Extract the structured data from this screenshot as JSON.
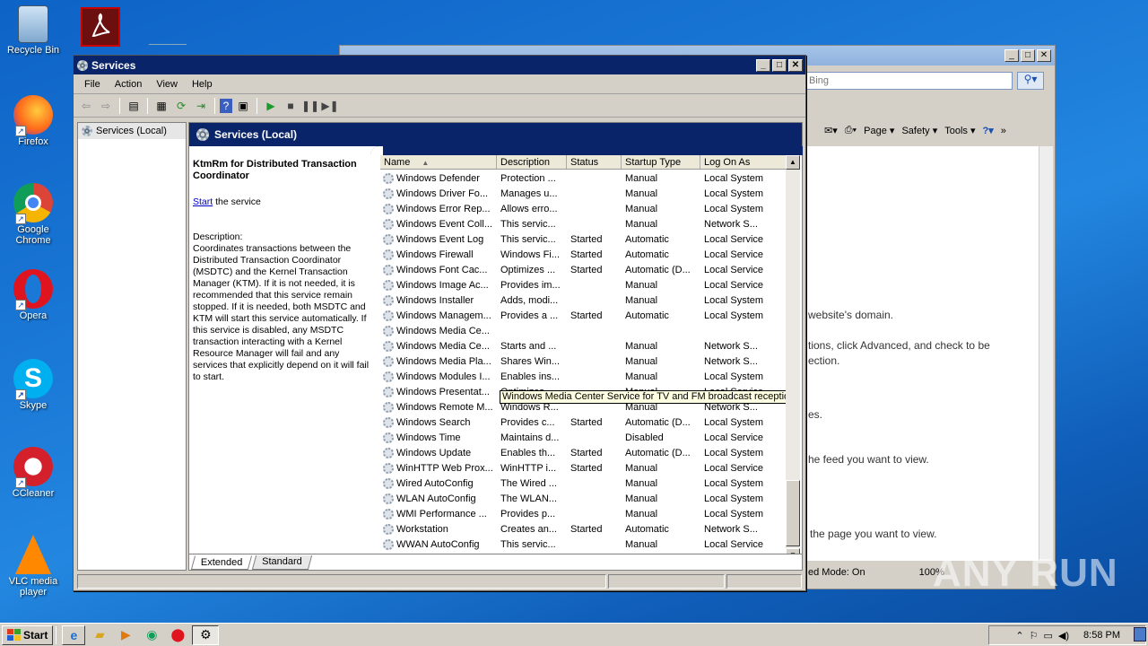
{
  "desktop": {
    "icons": [
      {
        "label": "Recycle Bin",
        "icon": "recycle-bin-icon"
      },
      {
        "label": "Firefox",
        "icon": "firefox-icon"
      },
      {
        "label": "Google Chrome",
        "icon": "chrome-icon"
      },
      {
        "label": "Opera",
        "icon": "opera-icon"
      },
      {
        "label": "Skype",
        "icon": "skype-icon"
      },
      {
        "label": "CCleaner",
        "icon": "ccleaner-icon"
      },
      {
        "label": "VLC media player",
        "icon": "vlc-icon"
      }
    ]
  },
  "ie": {
    "search_placeholder": "Bing",
    "menu": {
      "page": "Page",
      "safety": "Safety",
      "tools": "Tools"
    },
    "body_lines": [
      "website's domain.",
      "tions, click Advanced, and check to be",
      "ection.",
      "es.",
      "he feed you want to view.",
      "the page you want to view."
    ],
    "status_mode": "ed Mode: On",
    "zoom": "100%"
  },
  "services": {
    "title": "Services",
    "menu": [
      "File",
      "Action",
      "View",
      "Help"
    ],
    "tree_item": "Services (Local)",
    "header": "Services (Local)",
    "selected_service": "KtmRm for Distributed Transaction Coordinator",
    "start_link": "Start",
    "start_suffix": " the service",
    "description_label": "Description:",
    "description": "Coordinates transactions between the Distributed Transaction Coordinator (MSDTC) and the Kernel Transaction Manager (KTM). If it is not needed, it is recommended that this service remain stopped. If it is needed, both MSDTC and KTM will start this service automatically. If this service is disabled, any MSDTC transaction interacting with a Kernel Resource Manager will fail and any services that explicitly depend on it will fail to start.",
    "columns": [
      "Name",
      "Description",
      "Status",
      "Startup Type",
      "Log On As"
    ],
    "rows": [
      [
        "Windows Defender",
        "Protection ...",
        "",
        "Manual",
        "Local System"
      ],
      [
        "Windows Driver Fo...",
        "Manages u...",
        "",
        "Manual",
        "Local System"
      ],
      [
        "Windows Error Rep...",
        "Allows erro...",
        "",
        "Manual",
        "Local System"
      ],
      [
        "Windows Event Coll...",
        "This servic...",
        "",
        "Manual",
        "Network S..."
      ],
      [
        "Windows Event Log",
        "This servic...",
        "Started",
        "Automatic",
        "Local Service"
      ],
      [
        "Windows Firewall",
        "Windows Fi...",
        "Started",
        "Automatic",
        "Local Service"
      ],
      [
        "Windows Font Cac...",
        "Optimizes ...",
        "Started",
        "Automatic (D...",
        "Local Service"
      ],
      [
        "Windows Image Ac...",
        "Provides im...",
        "",
        "Manual",
        "Local Service"
      ],
      [
        "Windows Installer",
        "Adds, modi...",
        "",
        "Manual",
        "Local System"
      ],
      [
        "Windows Managem...",
        "Provides a ...",
        "Started",
        "Automatic",
        "Local System"
      ],
      [
        "Windows Media Ce...",
        "",
        "",
        "",
        ""
      ],
      [
        "Windows Media Ce...",
        "Starts and ...",
        "",
        "Manual",
        "Network S..."
      ],
      [
        "Windows Media Pla...",
        "Shares Win...",
        "",
        "Manual",
        "Network S..."
      ],
      [
        "Windows Modules I...",
        "Enables ins...",
        "",
        "Manual",
        "Local System"
      ],
      [
        "Windows Presentat...",
        "Optimizes ...",
        "",
        "Manual",
        "Local Service"
      ],
      [
        "Windows Remote M...",
        "Windows R...",
        "",
        "Manual",
        "Network S..."
      ],
      [
        "Windows Search",
        "Provides c...",
        "Started",
        "Automatic (D...",
        "Local System"
      ],
      [
        "Windows Time",
        "Maintains d...",
        "",
        "Disabled",
        "Local Service"
      ],
      [
        "Windows Update",
        "Enables th...",
        "Started",
        "Automatic (D...",
        "Local System"
      ],
      [
        "WinHTTP Web Prox...",
        "WinHTTP i...",
        "Started",
        "Manual",
        "Local Service"
      ],
      [
        "Wired AutoConfig",
        "The Wired ...",
        "",
        "Manual",
        "Local System"
      ],
      [
        "WLAN AutoConfig",
        "The WLAN...",
        "",
        "Manual",
        "Local System"
      ],
      [
        "WMI Performance ...",
        "Provides p...",
        "",
        "Manual",
        "Local System"
      ],
      [
        "Workstation",
        "Creates an...",
        "Started",
        "Automatic",
        "Network S..."
      ],
      [
        "WWAN AutoConfig",
        "This servic...",
        "",
        "Manual",
        "Local Service"
      ]
    ],
    "tooltip": "Windows Media Center Service for TV and FM broadcast reception",
    "tabs": [
      "Extended",
      "Standard"
    ]
  },
  "taskbar": {
    "start": "Start",
    "clock": "8:58 PM"
  },
  "watermark": "ANY RUN",
  "colors": {
    "titlebar": "#0a246a",
    "desktop": "#1a78d6",
    "tooltip": "#ffffe1"
  }
}
